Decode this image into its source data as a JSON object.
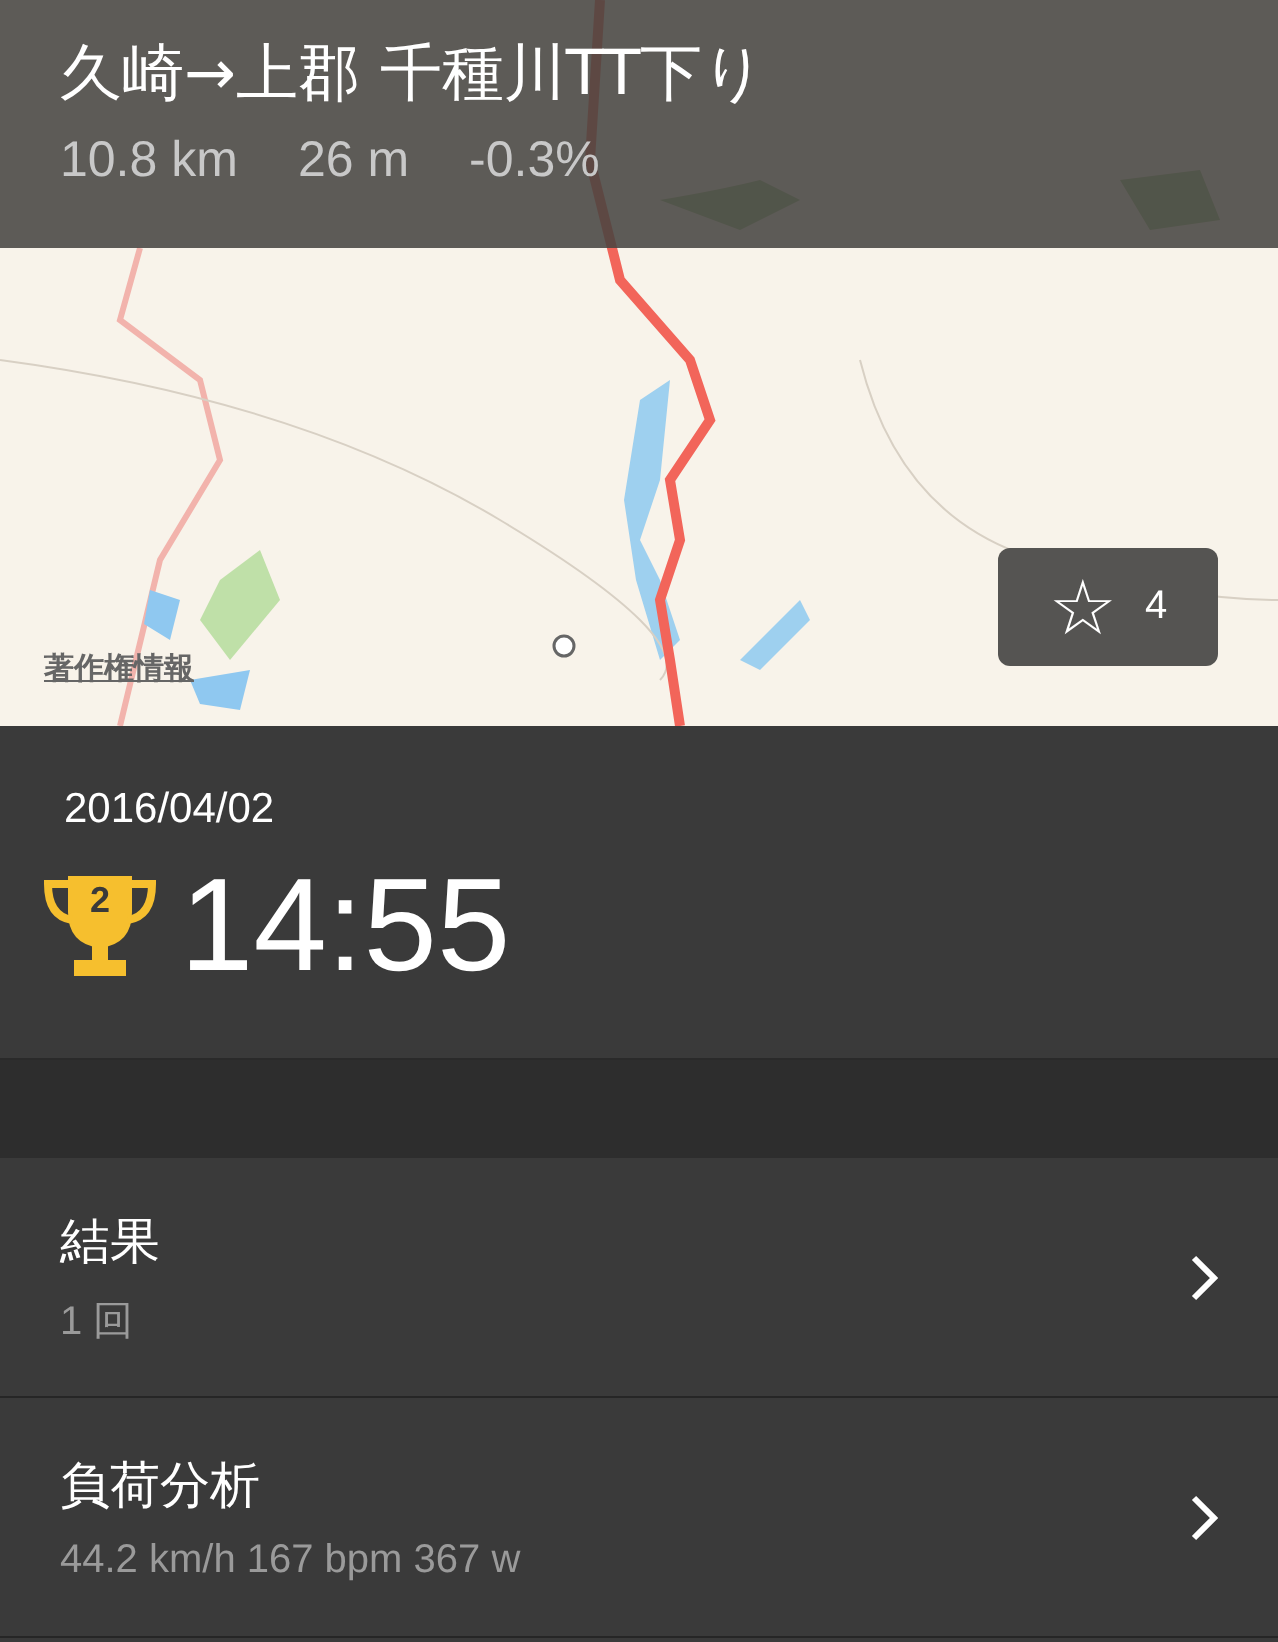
{
  "segment": {
    "title": "久崎→上郡 千種川TT下り",
    "distance": "10.8 km",
    "elevation": "26 m",
    "grade": "-0.3%"
  },
  "map": {
    "legal_link": "著作権情報",
    "star_button": {
      "icon": "☆",
      "count": "4"
    }
  },
  "effort": {
    "date": "2016/04/02",
    "rank": "2",
    "time": "14:55"
  },
  "rows": [
    {
      "title": "結果",
      "subtitle": "1 回"
    },
    {
      "title": "負荷分析",
      "subtitle": "44.2 km/h 167 bpm 367 w"
    }
  ]
}
